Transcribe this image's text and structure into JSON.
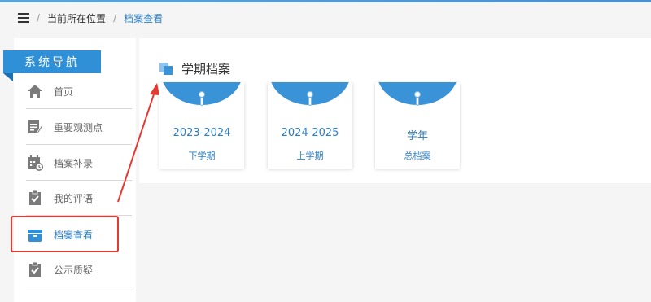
{
  "breadcrumb": {
    "separator": "/",
    "location_label": "当前所在位置",
    "current": "档案查看"
  },
  "sidebar": {
    "title": "系统导航",
    "items": [
      {
        "label": "首页",
        "icon": "home-icon"
      },
      {
        "label": "重要观测点",
        "icon": "edit-note-icon"
      },
      {
        "label": "档案补录",
        "icon": "calendar-clock-icon"
      },
      {
        "label": "我的评语",
        "icon": "clipboard-check-icon"
      },
      {
        "label": "档案查看",
        "icon": "archive-box-icon",
        "active": true
      },
      {
        "label": "公示质疑",
        "icon": "clipboard-check-icon"
      }
    ]
  },
  "main": {
    "section_title": "学期档案",
    "cards": [
      {
        "line1": "2023-2024",
        "line2": "下学期"
      },
      {
        "line1": "2024-2025",
        "line2": "上学期"
      },
      {
        "line1": "学年",
        "line2": "总档案"
      }
    ]
  },
  "colors": {
    "accent": "#2f8fd7",
    "card_cap": "#3a93d6",
    "link_text": "#2c7fc5",
    "annotation_red": "#e53a32"
  }
}
